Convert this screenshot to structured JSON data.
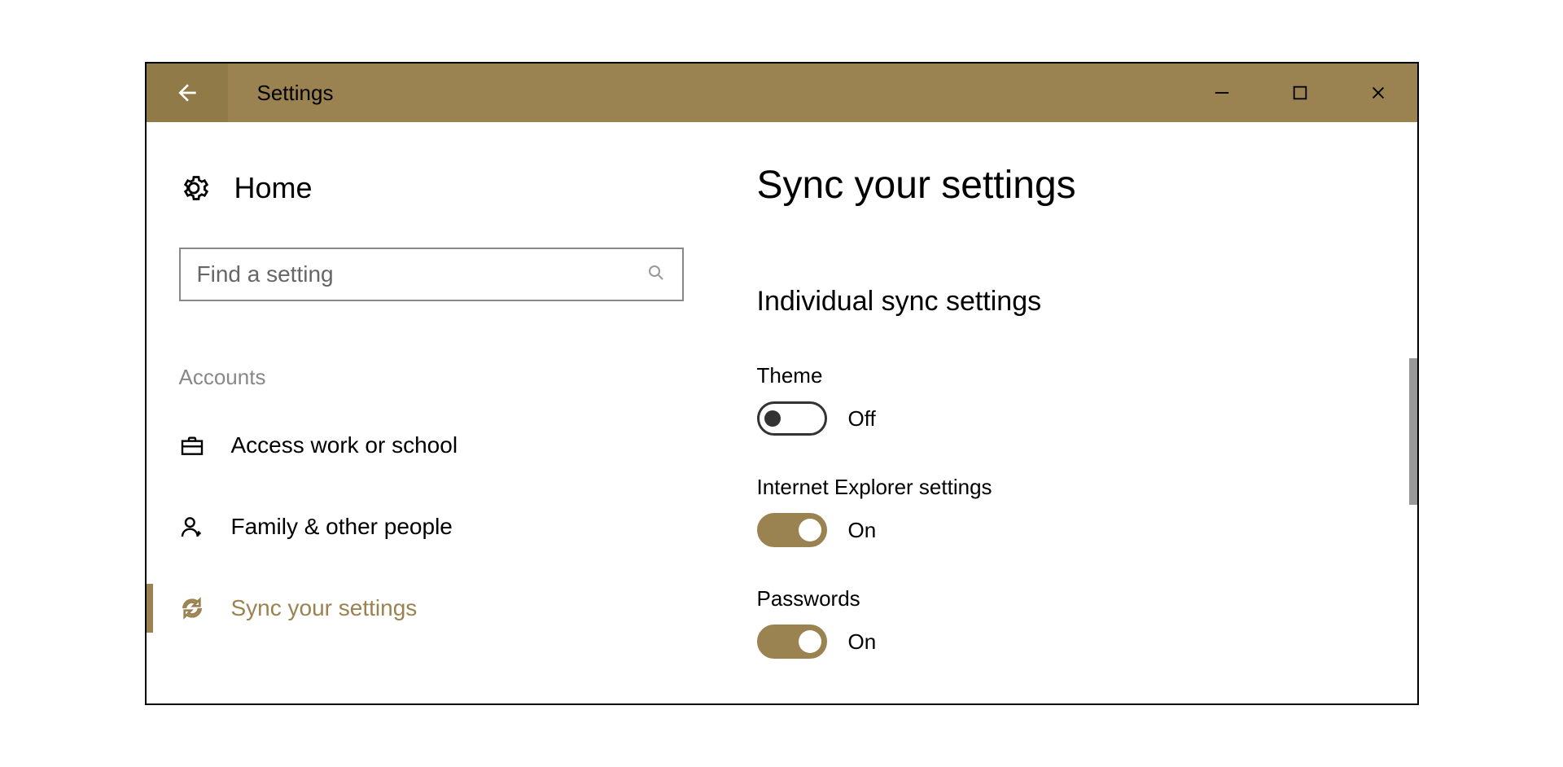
{
  "window": {
    "title": "Settings"
  },
  "sidebar": {
    "home": "Home",
    "search_placeholder": "Find a setting",
    "section": "Accounts",
    "items": [
      {
        "label": "Access work or school",
        "active": false
      },
      {
        "label": "Family & other people",
        "active": false
      },
      {
        "label": "Sync your settings",
        "active": true
      }
    ]
  },
  "main": {
    "title": "Sync your settings",
    "subheading": "Individual sync settings",
    "settings": [
      {
        "label": "Theme",
        "state": "Off",
        "on": false
      },
      {
        "label": "Internet Explorer settings",
        "state": "On",
        "on": true
      },
      {
        "label": "Passwords",
        "state": "On",
        "on": true
      }
    ]
  }
}
